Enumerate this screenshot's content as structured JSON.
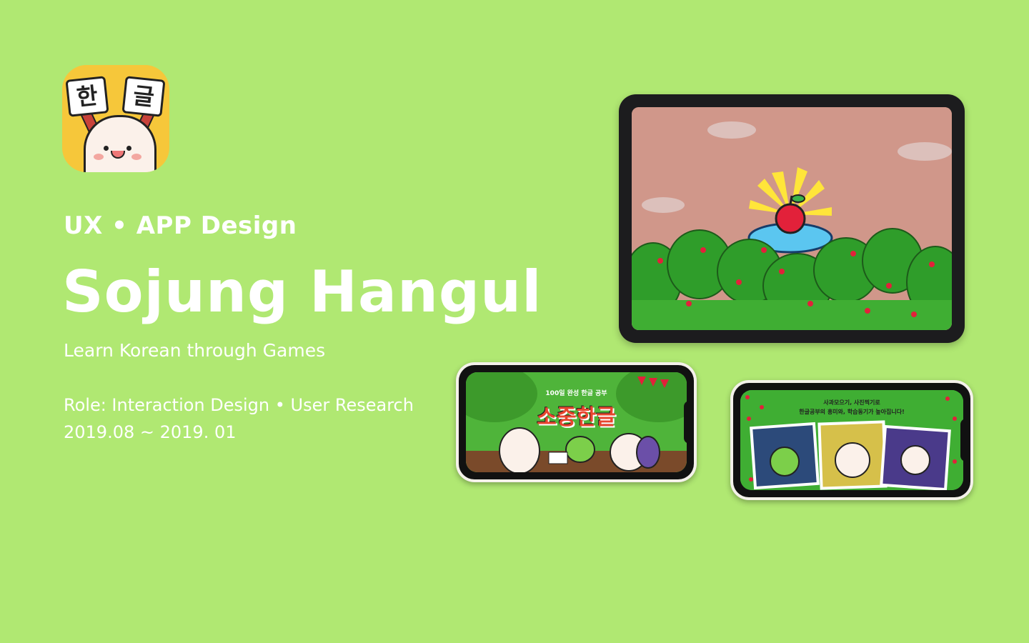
{
  "app_icon": {
    "left_char": "한",
    "right_char": "글"
  },
  "subtitle": "UX • APP Design",
  "title": "Sojung Hangul",
  "tagline": "Learn Korean through Games",
  "role": "Role: Interaction Design • User Research",
  "dates": "2019.08 ~ 2019. 01",
  "phone1": {
    "banner": "100일 완성 한글 공부",
    "logo": "소중한글"
  },
  "phone2": {
    "line1": "사과모으기, 사진찍기로",
    "line2": "한글공부의 흥미와, 학습동기가 높아집니다!"
  },
  "colors": {
    "background": "#b0e872",
    "tablet_sky": "#d0978a",
    "foliage": "#2f9d2a",
    "apple": "#e2213a"
  }
}
